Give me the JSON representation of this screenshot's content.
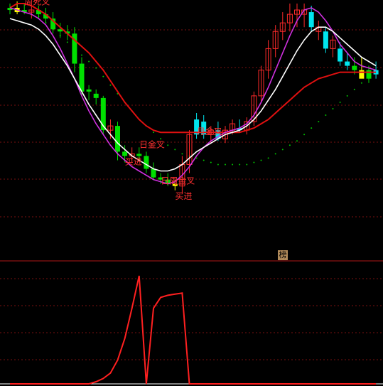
{
  "colors": {
    "background": "#000000",
    "grid": "#7a1010",
    "divider": "#b01818",
    "up_candle": "#ff2a2a",
    "down_candle": "#00e000",
    "cyan_candle": "#00e5ee",
    "yellow_candle": "#ffff00",
    "ma_red": "#e01010",
    "ma_white": "#ffffff",
    "ma_magenta": "#d030e0",
    "dots": "#00c000",
    "label": "#ff3030",
    "indicator": "#ff2020"
  },
  "badge": {
    "text": "榜"
  },
  "chart_data": [
    {
      "type": "candlestick",
      "panel": "price",
      "title": "",
      "price_range": [
        0,
        100
      ],
      "grid": true,
      "candles": [
        {
          "o": 98,
          "h": 101,
          "l": 96,
          "c": 99,
          "color": "down"
        },
        {
          "o": 99,
          "h": 102,
          "l": 96,
          "c": 97,
          "color": "yellow"
        },
        {
          "o": 98,
          "h": 101,
          "l": 96,
          "c": 97,
          "color": "down"
        },
        {
          "o": 97,
          "h": 100,
          "l": 94,
          "c": 98,
          "color": "up"
        },
        {
          "o": 98,
          "h": 100,
          "l": 94,
          "c": 96,
          "color": "down"
        },
        {
          "o": 96,
          "h": 99,
          "l": 92,
          "c": 94,
          "color": "down"
        },
        {
          "o": 94,
          "h": 97,
          "l": 87,
          "c": 89,
          "color": "down"
        },
        {
          "o": 89,
          "h": 92,
          "l": 85,
          "c": 88,
          "color": "down"
        },
        {
          "o": 88,
          "h": 91,
          "l": 84,
          "c": 87,
          "color": "down"
        },
        {
          "o": 87,
          "h": 90,
          "l": 69,
          "c": 73,
          "color": "down"
        },
        {
          "o": 73,
          "h": 76,
          "l": 58,
          "c": 60,
          "color": "down"
        },
        {
          "o": 61,
          "h": 63,
          "l": 56,
          "c": 60,
          "color": "down"
        },
        {
          "o": 59,
          "h": 61,
          "l": 54,
          "c": 57,
          "color": "down"
        },
        {
          "o": 57,
          "h": 58,
          "l": 40,
          "c": 42,
          "color": "down"
        },
        {
          "o": 42,
          "h": 47,
          "l": 38,
          "c": 44,
          "color": "up"
        },
        {
          "o": 44,
          "h": 46,
          "l": 28,
          "c": 32,
          "color": "down"
        },
        {
          "o": 32,
          "h": 35,
          "l": 27,
          "c": 30,
          "color": "down"
        },
        {
          "o": 30,
          "h": 34,
          "l": 27,
          "c": 31,
          "color": "up"
        },
        {
          "o": 31,
          "h": 34,
          "l": 28,
          "c": 30,
          "color": "down"
        },
        {
          "o": 30,
          "h": 32,
          "l": 22,
          "c": 24,
          "color": "down"
        },
        {
          "o": 24,
          "h": 27,
          "l": 19,
          "c": 20,
          "color": "down"
        },
        {
          "o": 20,
          "h": 22,
          "l": 17,
          "c": 19,
          "color": "down"
        },
        {
          "o": 19,
          "h": 22,
          "l": 16,
          "c": 17,
          "color": "down"
        },
        {
          "o": 17,
          "h": 19,
          "l": 14,
          "c": 16,
          "color": "yellow"
        },
        {
          "o": 16,
          "h": 30,
          "l": 13,
          "c": 26,
          "color": "up"
        },
        {
          "o": 26,
          "h": 42,
          "l": 22,
          "c": 40,
          "color": "up"
        },
        {
          "o": 47,
          "h": 50,
          "l": 38,
          "c": 40,
          "color": "cyan"
        },
        {
          "o": 46,
          "h": 49,
          "l": 38,
          "c": 40,
          "color": "cyan"
        },
        {
          "o": 40,
          "h": 44,
          "l": 36,
          "c": 42,
          "color": "up"
        },
        {
          "o": 42,
          "h": 46,
          "l": 37,
          "c": 38,
          "color": "cyan"
        },
        {
          "o": 38,
          "h": 44,
          "l": 36,
          "c": 42,
          "color": "up"
        },
        {
          "o": 42,
          "h": 47,
          "l": 40,
          "c": 45,
          "color": "up"
        },
        {
          "o": 43,
          "h": 47,
          "l": 41,
          "c": 42,
          "color": "cyan"
        },
        {
          "o": 42,
          "h": 48,
          "l": 40,
          "c": 46,
          "color": "up"
        },
        {
          "o": 46,
          "h": 60,
          "l": 44,
          "c": 58,
          "color": "up"
        },
        {
          "o": 58,
          "h": 72,
          "l": 55,
          "c": 70,
          "color": "up"
        },
        {
          "o": 70,
          "h": 84,
          "l": 66,
          "c": 80,
          "color": "up"
        },
        {
          "o": 80,
          "h": 91,
          "l": 76,
          "c": 88,
          "color": "up"
        },
        {
          "o": 88,
          "h": 97,
          "l": 84,
          "c": 92,
          "color": "up"
        },
        {
          "o": 92,
          "h": 101,
          "l": 88,
          "c": 96,
          "color": "up"
        },
        {
          "o": 96,
          "h": 101,
          "l": 90,
          "c": 98,
          "color": "up"
        },
        {
          "o": 96,
          "h": 101,
          "l": 90,
          "c": 98,
          "color": "up"
        },
        {
          "o": 97,
          "h": 100,
          "l": 88,
          "c": 90,
          "color": "cyan"
        },
        {
          "o": 90,
          "h": 93,
          "l": 84,
          "c": 88,
          "color": "up"
        },
        {
          "o": 88,
          "h": 90,
          "l": 78,
          "c": 80,
          "color": "cyan"
        },
        {
          "o": 80,
          "h": 86,
          "l": 76,
          "c": 84,
          "color": "up"
        },
        {
          "o": 80,
          "h": 83,
          "l": 72,
          "c": 74,
          "color": "cyan"
        },
        {
          "o": 74,
          "h": 78,
          "l": 70,
          "c": 72,
          "color": "cyan"
        },
        {
          "o": 72,
          "h": 76,
          "l": 68,
          "c": 70,
          "color": "down"
        },
        {
          "o": 70,
          "h": 76,
          "l": 67,
          "c": 66,
          "color": "yellow"
        },
        {
          "o": 66,
          "h": 72,
          "l": 64,
          "c": 70,
          "color": "down"
        },
        {
          "o": 70,
          "h": 74,
          "l": 66,
          "c": 68,
          "color": "cyan"
        }
      ],
      "ma_white": [
        94,
        93,
        92,
        91,
        89,
        86,
        82,
        77,
        72,
        66,
        60,
        54,
        49,
        44,
        40,
        36,
        33,
        30,
        28,
        26,
        24,
        23,
        23,
        24,
        26,
        29,
        32,
        34,
        36,
        38,
        40,
        41,
        42,
        44,
        47,
        51,
        56,
        61,
        67,
        73,
        79,
        84,
        88,
        90,
        90,
        88,
        85,
        82,
        79,
        76,
        74,
        72
      ],
      "ma_magenta": [
        99,
        98,
        97,
        96,
        94,
        91,
        86,
        80,
        73,
        66,
        58,
        51,
        45,
        40,
        35,
        31,
        28,
        25,
        23,
        21,
        19,
        18,
        17,
        18,
        21,
        25,
        30,
        34,
        37,
        39,
        41,
        42,
        43,
        45,
        49,
        55,
        62,
        70,
        78,
        86,
        93,
        98,
        99,
        97,
        93,
        88,
        82,
        78,
        74,
        72,
        71,
        70
      ],
      "ma_red": [
        99,
        101,
        101,
        100,
        98,
        96,
        93,
        90,
        87,
        84,
        81,
        78,
        74,
        70,
        65,
        60,
        55,
        51,
        47,
        44,
        42,
        41,
        41,
        41,
        41,
        41,
        41,
        41,
        41,
        41,
        41,
        41,
        41,
        42,
        43,
        45,
        47,
        50,
        53,
        56,
        59,
        62,
        64,
        66,
        67,
        68,
        69,
        69,
        69,
        69,
        69,
        69
      ],
      "dots": [
        null,
        null,
        null,
        null,
        95,
        92,
        89,
        86,
        83,
        80,
        77,
        74,
        71,
        67,
        63,
        59,
        55,
        51,
        47,
        44,
        41,
        38,
        35,
        33,
        31,
        30,
        29,
        28,
        27,
        26,
        26,
        26,
        26,
        26,
        27,
        28,
        29,
        31,
        33,
        35,
        37,
        40,
        43,
        46,
        49,
        52,
        55,
        58,
        61,
        64,
        67,
        70
      ],
      "annotations": [
        {
          "text": "周死叉",
          "i": 3,
          "y": 100.5
        },
        {
          "text": "日金叉",
          "i": 19,
          "y": 34
        },
        {
          "text": "买进",
          "i": 17,
          "y": 26
        },
        {
          "text": "日周金叉",
          "i": 22,
          "y": 17
        },
        {
          "text": "买进",
          "i": 24,
          "y": 10
        },
        {
          "text": "月金叉",
          "i": 27,
          "y": 40
        }
      ]
    },
    {
      "type": "line",
      "panel": "indicator",
      "title": "",
      "ylim": [
        0,
        100
      ],
      "series": [
        {
          "values": [
            0,
            0,
            0,
            0,
            0,
            0,
            0,
            0,
            0,
            0,
            0,
            0,
            2,
            5,
            10,
            22,
            42,
            70,
            100,
            0,
            70,
            80,
            82,
            83,
            84,
            0,
            0,
            0,
            0,
            0,
            0,
            0,
            0,
            0,
            0,
            0,
            0,
            0,
            0,
            0,
            0,
            0,
            0,
            0,
            0,
            0,
            0,
            0,
            0,
            0,
            0,
            0
          ]
        }
      ]
    }
  ]
}
